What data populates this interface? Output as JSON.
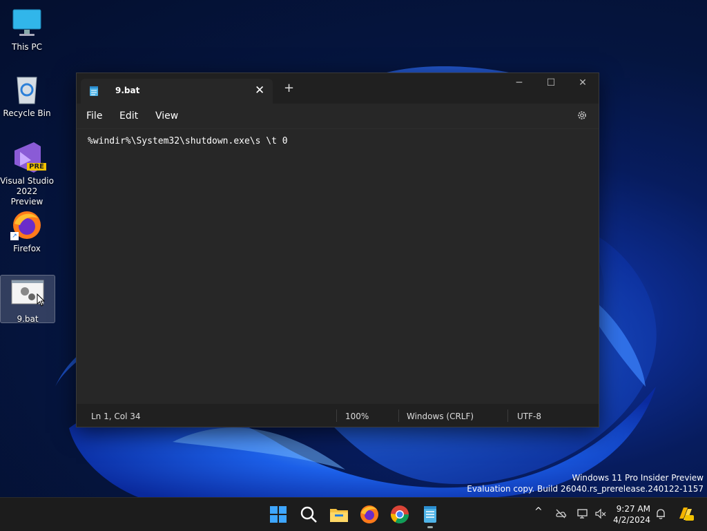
{
  "desktop": {
    "icons": [
      {
        "label": "This PC",
        "icon": "monitor-icon"
      },
      {
        "label": "Recycle Bin",
        "icon": "recycle-bin-icon"
      },
      {
        "label": "Visual Studio 2022 Preview",
        "icon": "visual-studio-icon",
        "badge": "PRE"
      },
      {
        "label": "Firefox",
        "icon": "firefox-icon"
      },
      {
        "label": "9.bat",
        "icon": "batch-file-icon"
      }
    ]
  },
  "notepad": {
    "tab_title": "9.bat",
    "close_glyph": "✕",
    "new_tab_glyph": "+",
    "controls": {
      "minimize": "─",
      "maximize": "☐",
      "close": "✕"
    },
    "menu": {
      "file": "File",
      "edit": "Edit",
      "view": "View"
    },
    "content": "%windir%\\System32\\shutdown.exe\\s \\t 0",
    "status": {
      "position": "Ln 1, Col 34",
      "zoom": "100%",
      "line_ending": "Windows (CRLF)",
      "encoding": "UTF-8"
    }
  },
  "watermark": {
    "line1": "Windows 11 Pro Insider Preview",
    "line2": "Evaluation copy. Build 26040.rs_prerelease.240122-1157"
  },
  "taskbar": {
    "apps": [
      "start-icon",
      "search-icon",
      "file-explorer-icon",
      "firefox-icon",
      "chrome-icon",
      "notepad-icon"
    ],
    "tray_chevron": "^",
    "clock": {
      "time": "9:27 AM",
      "date": "4/2/2024"
    }
  },
  "colors": {
    "accent": "#0078d4",
    "window_bg": "#272727",
    "titlebar_bg": "#202020"
  }
}
